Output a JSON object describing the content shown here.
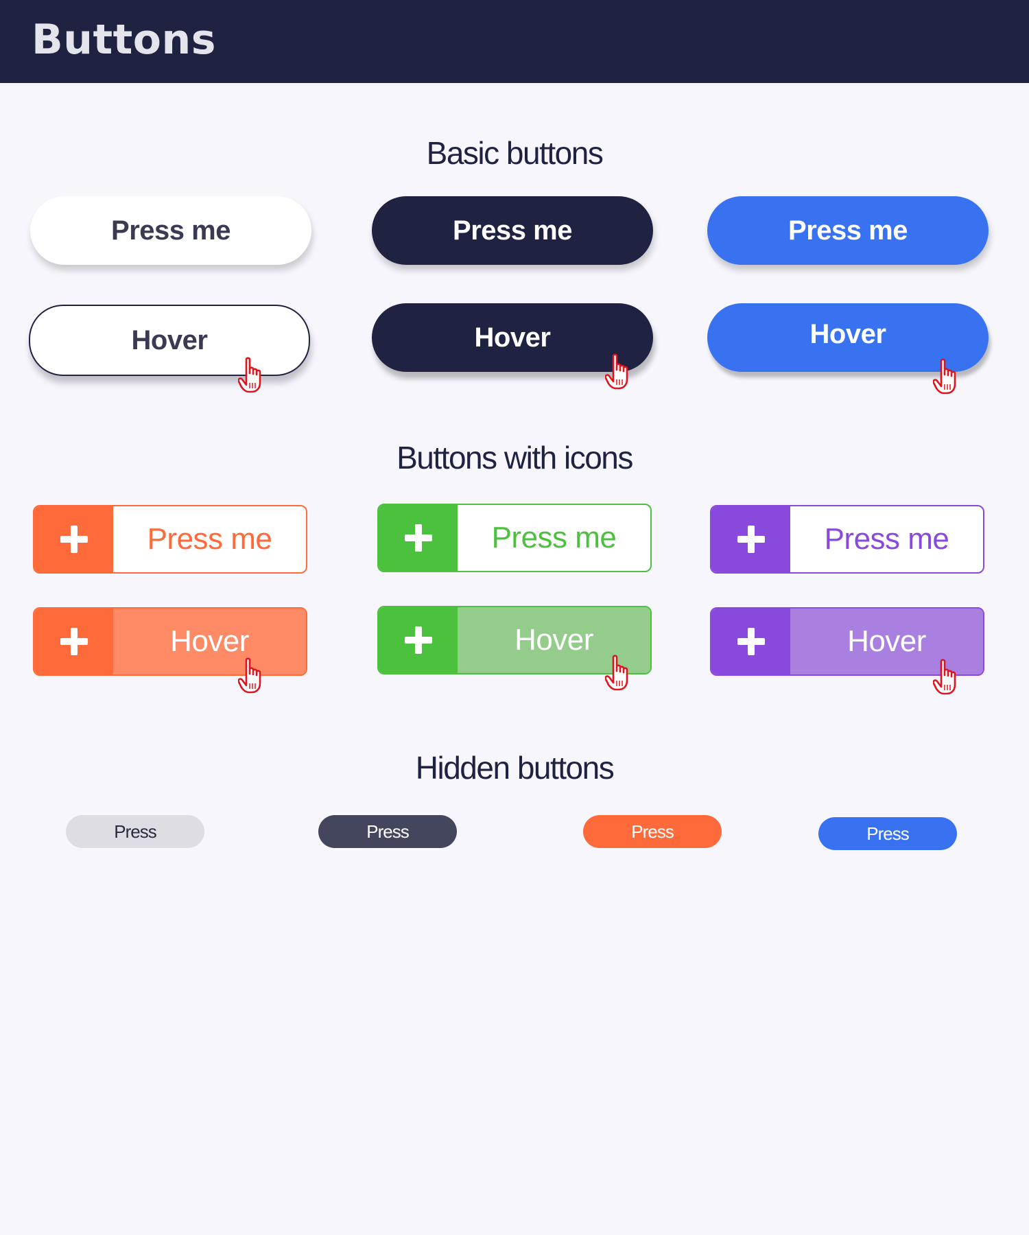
{
  "header": {
    "title": "Buttons"
  },
  "colors": {
    "navy": "#1f2240",
    "blue": "#3872f0",
    "orange": "#ff6a3a",
    "green": "#4cc13e",
    "purple": "#8a49dd",
    "cursor_red": "#e0141e"
  },
  "sections": {
    "basic": {
      "title": "Basic buttons",
      "press_label": "Press me",
      "hover_label": "Hover"
    },
    "icons": {
      "title": "Buttons with icons",
      "press_label": "Press me",
      "hover_label": "Hover",
      "icon": "plus-icon"
    },
    "hidden": {
      "title": "Hidden buttons",
      "labels": [
        "Press",
        "Press",
        "Press",
        "Press"
      ]
    }
  }
}
